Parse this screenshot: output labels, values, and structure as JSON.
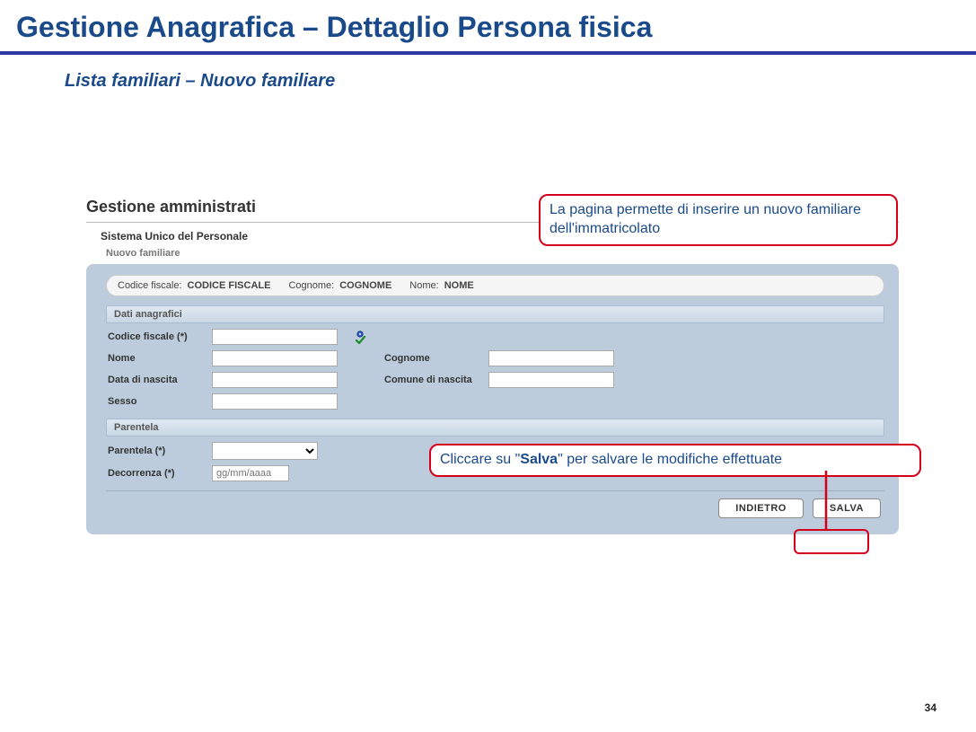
{
  "slide": {
    "title": "Gestione Anagrafica – Dettaglio Persona fisica",
    "subtitle": "Lista familiari – Nuovo familiare",
    "page_number": "34"
  },
  "app": {
    "title": "Gestione amministrati",
    "system_label": "Sistema Unico del Personale",
    "page_label": "Nuovo familiare"
  },
  "summary": {
    "cf_label": "Codice fiscale:",
    "cf_value": "CODICE FISCALE",
    "cognome_label": "Cognome:",
    "cognome_value": "COGNOME",
    "nome_label": "Nome:",
    "nome_value": "NOME"
  },
  "sections": {
    "anagrafici": "Dati anagrafici",
    "parentela": "Parentela"
  },
  "fields": {
    "codice_fiscale": {
      "label": "Codice fiscale (*)",
      "value": ""
    },
    "nome": {
      "label": "Nome",
      "value": ""
    },
    "cognome": {
      "label": "Cognome",
      "value": ""
    },
    "data_nascita": {
      "label": "Data di nascita",
      "value": ""
    },
    "comune_nascita": {
      "label": "Comune di nascita",
      "value": ""
    },
    "sesso": {
      "label": "Sesso",
      "value": ""
    },
    "parentela": {
      "label": "Parentela (*)",
      "value": ""
    },
    "decorrenza": {
      "label": "Decorrenza (*)",
      "value": "",
      "placeholder": "gg/mm/aaaa"
    }
  },
  "buttons": {
    "indietro": "INDIETRO",
    "salva": "SALVA"
  },
  "callouts": {
    "top": "La pagina permette di inserire un nuovo familiare dell'immatricolato",
    "mid_prefix": "Cliccare su \"",
    "mid_bold": "Salva",
    "mid_suffix": "\" per salvare le modifiche effettuate"
  },
  "icons": {
    "validate": "validate-icon"
  }
}
